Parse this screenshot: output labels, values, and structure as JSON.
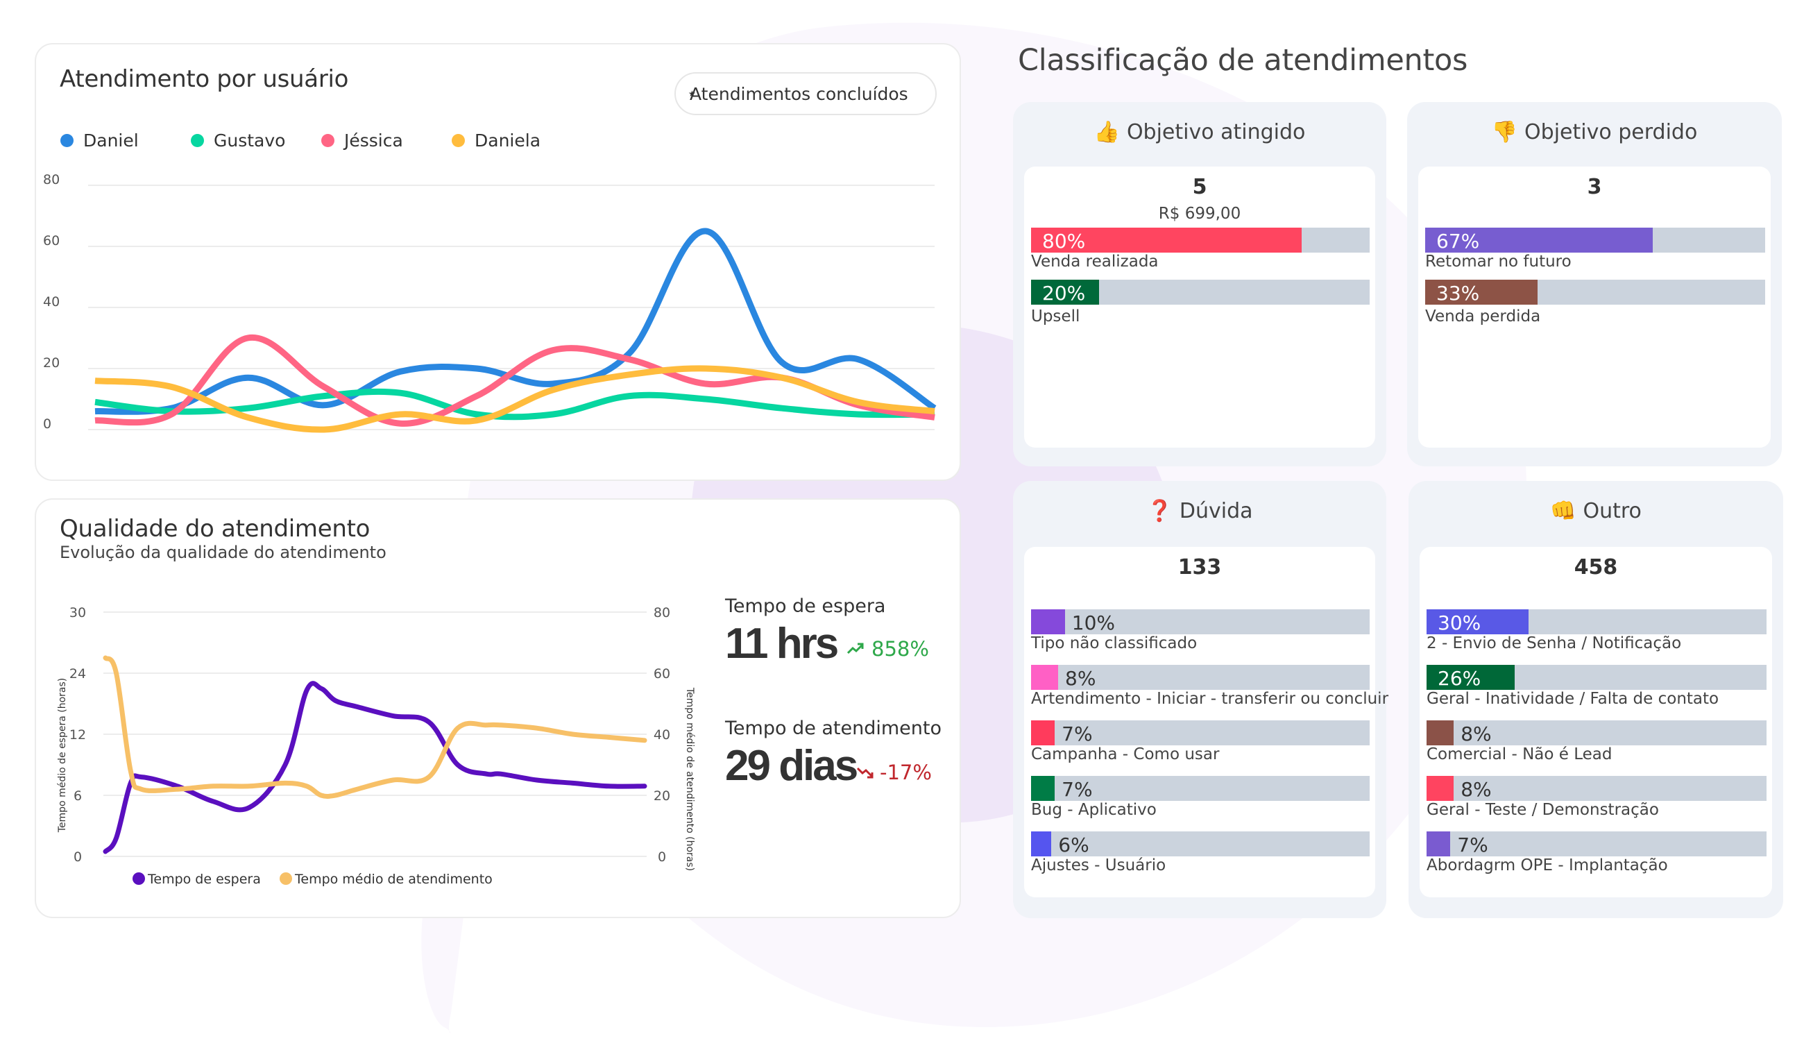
{
  "usuarios_card": {
    "title": "Atendimento por usuário",
    "select": {
      "value": "Atendimentos concluídos"
    },
    "legend": [
      {
        "name": "Daniel",
        "color": "#2a87e0"
      },
      {
        "name": "Gustavo",
        "color": "#06d6a0"
      },
      {
        "name": "Jéssica",
        "color": "#ff6584"
      },
      {
        "name": "Daniela",
        "color": "#ffbc3d"
      }
    ]
  },
  "qualidade_card": {
    "title": "Qualidade do atendimento",
    "subtitle": "Evolução da qualidade do atendimento",
    "legend": [
      {
        "name": "Tempo de espera",
        "color": "#5a0fbf"
      },
      {
        "name": "Tempo médio de atendimento",
        "color": "#f7c067"
      }
    ],
    "stats": [
      {
        "label": "Tempo de espera",
        "value": "11 hrs",
        "delta": "858%",
        "trend": "up",
        "icon": "trending-up-icon"
      },
      {
        "label": "Tempo de atendimento",
        "value": "29 dias",
        "delta": "-17%",
        "trend": "down",
        "icon": "trending-down-icon"
      }
    ]
  },
  "classificacao": {
    "title": "Classificação de atendimentos",
    "cards": [
      {
        "id": "objetivo-atingido",
        "title": "Objetivo atingido",
        "emoji": "👍",
        "icon": "thumbs-up-icon",
        "total": "5",
        "money": "R$ 699,00",
        "items": [
          {
            "pct": 80,
            "pct_label": "80%",
            "label": "Venda realizada",
            "color": "#ff4560"
          },
          {
            "pct": 20,
            "pct_label": "20%",
            "label": "Upsell",
            "color": "#00693a"
          }
        ]
      },
      {
        "id": "objetivo-perdido",
        "title": "Objetivo perdido",
        "emoji": "👎",
        "icon": "thumbs-down-icon",
        "total": "3",
        "money": "",
        "items": [
          {
            "pct": 67,
            "pct_label": "67%",
            "label": "Retomar no futuro",
            "color": "#775dd0"
          },
          {
            "pct": 33,
            "pct_label": "33%",
            "label": "Venda perdida",
            "color": "#8d5346"
          }
        ]
      },
      {
        "id": "duvida",
        "title": "Dúvida",
        "emoji": "❓",
        "icon": "question-icon",
        "total": "133",
        "money": "",
        "items": [
          {
            "pct": 10,
            "pct_label": "10%",
            "label": "Tipo não classificado",
            "color": "#8549db"
          },
          {
            "pct": 8,
            "pct_label": "8%",
            "label": "Artendimento - Iniciar - transferir ou concluir",
            "color": "#ff60c5"
          },
          {
            "pct": 7,
            "pct_label": "7%",
            "label": "Campanha - Como usar",
            "color": "#ff3b5c"
          },
          {
            "pct": 7,
            "pct_label": "7%",
            "label": "Bug - Aplicativo",
            "color": "#007c46"
          },
          {
            "pct": 6,
            "pct_label": "6%",
            "label": "Ajustes - Usuário",
            "color": "#5555ef"
          }
        ]
      },
      {
        "id": "outro",
        "title": "Outro",
        "emoji": "👊",
        "icon": "fist-icon",
        "total": "458",
        "money": "",
        "items": [
          {
            "pct": 30,
            "pct_label": "30%",
            "label": "2 - Envio de Senha / Notificação",
            "color": "#5959e6"
          },
          {
            "pct": 26,
            "pct_label": "26%",
            "label": "Geral - Inatividade / Falta de contato",
            "color": "#006838"
          },
          {
            "pct": 8,
            "pct_label": "8%",
            "label": "Comercial - Não é Lead",
            "color": "#8b5248"
          },
          {
            "pct": 8,
            "pct_label": "8%",
            "label": "Geral - Teste / Demonstração",
            "color": "#ff4460"
          },
          {
            "pct": 7,
            "pct_label": "7%",
            "label": "Abordagrm OPE - Implantação",
            "color": "#7a5bd0"
          }
        ]
      }
    ]
  },
  "chart_data": [
    {
      "type": "line",
      "title": "Atendimento por usuário",
      "xlabel": "",
      "ylabel": "",
      "ylim": [
        0,
        80
      ],
      "yticks": [
        0,
        20,
        40,
        60,
        80
      ],
      "grid": true,
      "legend": "top-left",
      "smooth": true,
      "x": [
        0,
        1,
        2,
        3,
        4,
        5,
        6,
        7,
        8,
        9,
        10,
        11
      ],
      "series": [
        {
          "name": "Daniel",
          "color": "#2a87e0",
          "values": [
            6,
            7,
            17,
            8,
            19,
            20,
            15,
            25,
            65,
            22,
            23,
            7
          ]
        },
        {
          "name": "Gustavo",
          "color": "#06d6a0",
          "values": [
            9,
            6,
            7,
            11,
            12,
            5,
            5,
            11,
            10,
            7,
            5,
            5
          ]
        },
        {
          "name": "Jéssica",
          "color": "#ff6584",
          "values": [
            3,
            5,
            30,
            14,
            2,
            11,
            26,
            23,
            15,
            17,
            8,
            4
          ]
        },
        {
          "name": "Daniela",
          "color": "#ffbc3d",
          "values": [
            16,
            14,
            4,
            0,
            5,
            3,
            13,
            18,
            20,
            17,
            9,
            6
          ]
        }
      ]
    },
    {
      "type": "line",
      "title": "Evolução da qualidade do atendimento",
      "xlabel": "",
      "ylabel": "Tempo médio de espera (horas)",
      "ylabel_right": "Tempo médio de atendimento (horas)",
      "yticks_left": [
        0,
        6,
        12,
        24,
        30
      ],
      "yticks_right": [
        0,
        20,
        40,
        60,
        80
      ],
      "ylim_right": [
        0,
        80
      ],
      "grid": true,
      "legend": "bottom",
      "x": [
        0,
        0.3,
        0.7,
        1,
        2,
        3,
        4,
        5,
        5.6,
        6,
        6.4,
        7,
        8,
        9,
        9.8,
        10.6,
        11,
        12,
        13,
        14,
        15
      ],
      "series": [
        {
          "name": "Tempo de espera",
          "color": "#5a0fbf",
          "axis": "left",
          "values_in_tick_units": [
            0.08,
            0.3,
            1.2,
            1.3,
            1.15,
            0.9,
            0.8,
            1.5,
            2.72,
            2.75,
            2.55,
            2.45,
            2.3,
            2.2,
            1.5,
            1.35,
            1.35,
            1.25,
            1.2,
            1.15,
            1.15
          ]
        },
        {
          "name": "Tempo médio de atendimento",
          "color": "#f7c067",
          "axis": "right",
          "values": [
            65,
            60,
            28,
            22,
            22,
            23,
            23,
            24,
            23,
            20,
            20,
            22,
            25,
            26,
            42,
            43,
            43,
            42,
            40,
            39,
            38
          ]
        }
      ]
    }
  ]
}
